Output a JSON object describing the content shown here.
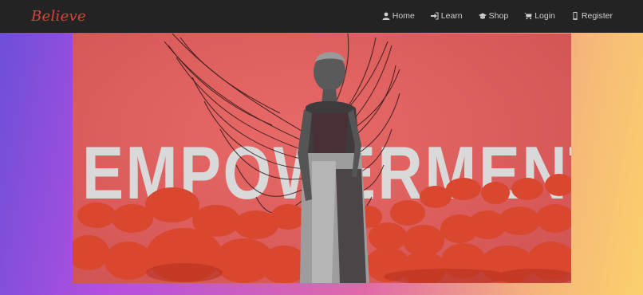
{
  "brand": {
    "name": "Believe"
  },
  "nav": {
    "items": [
      {
        "label": "Home",
        "icon": "user-icon"
      },
      {
        "label": "Learn",
        "icon": "sign-in-icon"
      },
      {
        "label": "Shop",
        "icon": "graduation-cap-icon"
      },
      {
        "label": "Login",
        "icon": "shopping-cart-icon"
      },
      {
        "label": "Register",
        "icon": "mobile-icon"
      }
    ]
  },
  "banner": {
    "word": "EMPOWERMENT"
  },
  "colors": {
    "navbar": "#232323",
    "brand": "#e0403a",
    "banner_bg": "#dd5f5e",
    "pots": "#d9472f"
  }
}
